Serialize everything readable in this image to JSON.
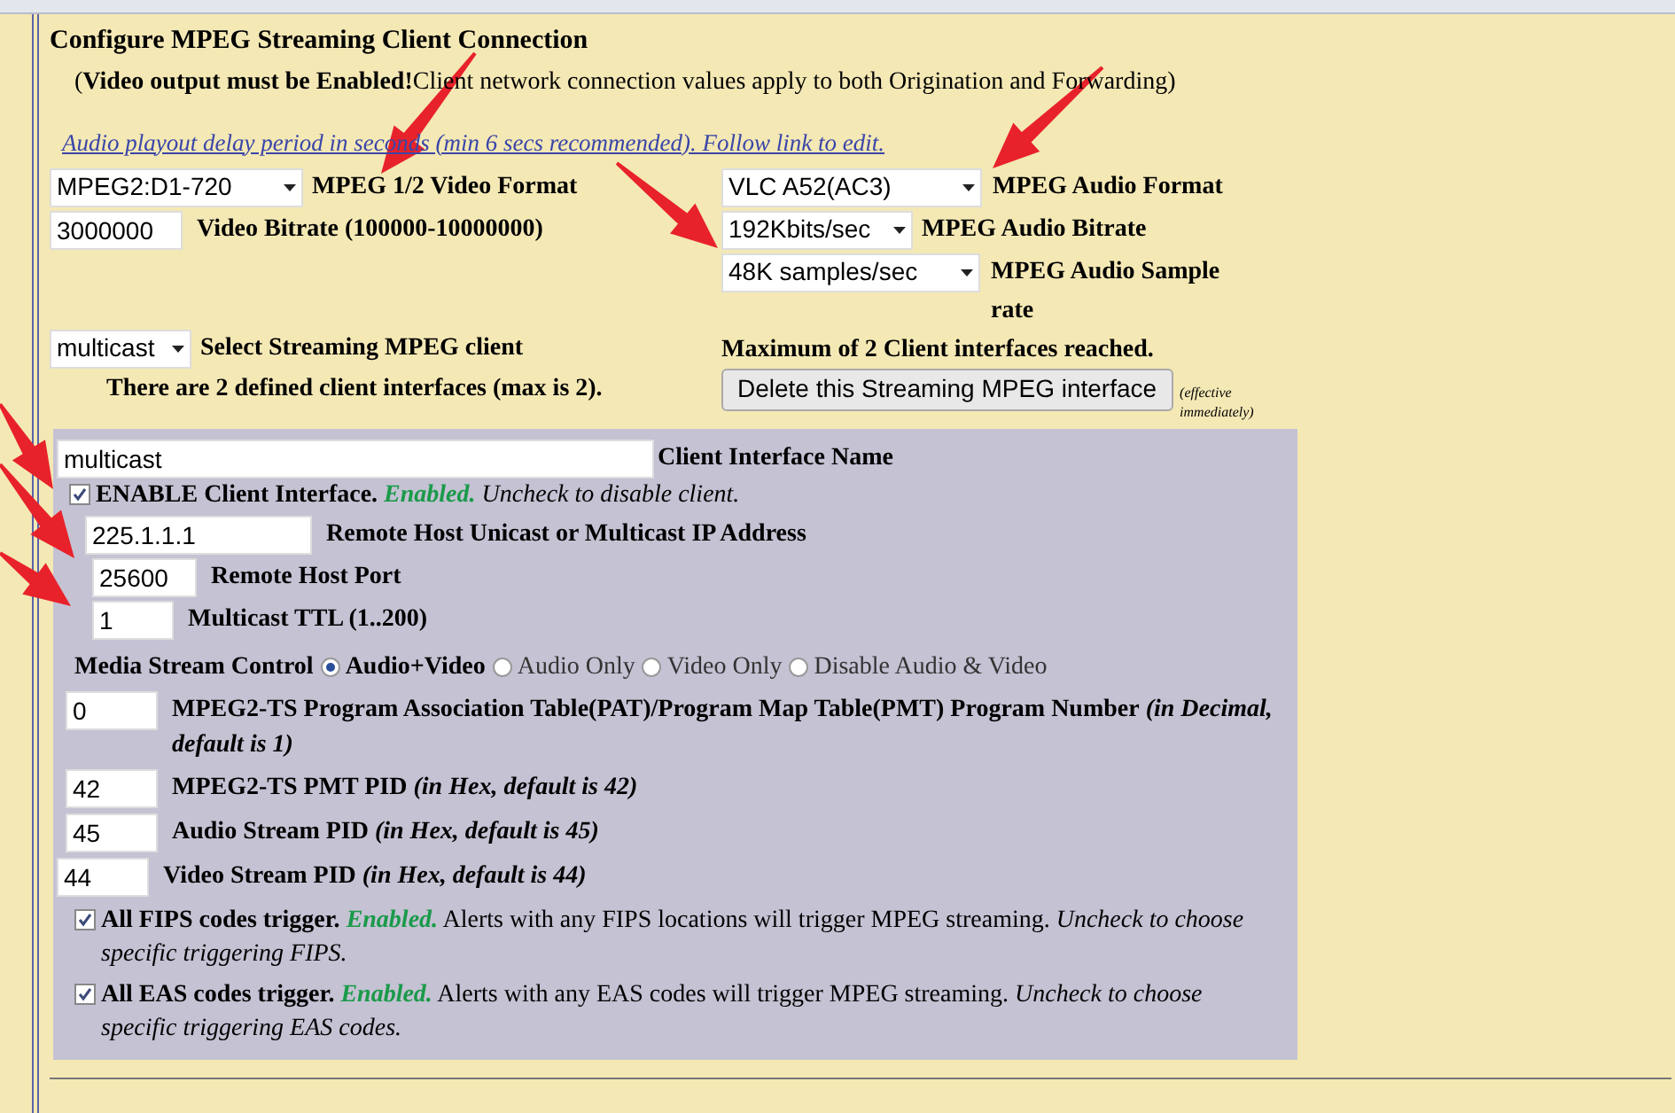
{
  "title": "Configure MPEG Streaming Client Connection",
  "note": "(**Video output must be Enabled!**Client network connection values apply to both Origination and Forwarding)",
  "link": "Audio playout delay period in seconds (min 6 secs recommended). Follow link to edit.",
  "video_format": {
    "value": "MPEG2:D1-720",
    "label": "MPEG 1/2 Video Format"
  },
  "video_bitrate": {
    "value": "3000000",
    "label": "Video Bitrate (100000-10000000)"
  },
  "audio_format": {
    "value": "VLC A52(AC3)",
    "label": "MPEG Audio Format"
  },
  "audio_bitrate": {
    "value": "192Kbits/sec",
    "label": "MPEG Audio Bitrate"
  },
  "audio_sample_rate": {
    "value": "48K samples/sec",
    "label": "MPEG Audio Sample rate"
  },
  "client_select": {
    "value": "multicast",
    "label": "Select Streaming MPEG client"
  },
  "client_count": "There are 2 defined client interfaces (max is 2).",
  "max_note": "Maximum of 2 Client interfaces reached.",
  "delete_button": "Delete this Streaming MPEG interface",
  "delete_note": "(effective immediately)",
  "client": {
    "name": {
      "value": "multicast",
      "label": "Client Interface Name"
    },
    "enable": {
      "checked": true,
      "label": "ENABLE Client Interface.",
      "status": "Enabled.",
      "hint": "Uncheck to disable client."
    },
    "host": {
      "value": "225.1.1.1",
      "label": "Remote Host Unicast or Multicast IP Address"
    },
    "port": {
      "value": "25600",
      "label": "Remote Host Port"
    },
    "ttl": {
      "value": "1",
      "label": "Multicast TTL (1..200)"
    },
    "media_stream_control": {
      "label": "Media Stream Control",
      "options": [
        {
          "label": "Audio+Video",
          "selected": true
        },
        {
          "label": "Audio Only",
          "selected": false
        },
        {
          "label": "Video Only",
          "selected": false
        },
        {
          "label": "Disable Audio & Video",
          "selected": false
        }
      ]
    },
    "pid_fields": [
      {
        "value": "0",
        "label": "MPEG2-TS Program Association Table(PAT)/Program Map Table(PMT) Program Number",
        "hint": "(in Decimal, default is 1)"
      },
      {
        "value": "42",
        "label": "MPEG2-TS PMT PID",
        "hint": "(in Hex, default is 42)"
      },
      {
        "value": "45",
        "label": "Audio Stream PID",
        "hint": "(in Hex, default is 45)"
      },
      {
        "value": "44",
        "label": "Video Stream PID",
        "hint": "(in Hex, default is 44)"
      }
    ],
    "triggers": [
      {
        "checked": true,
        "label": "All FIPS codes trigger.",
        "status": "Enabled.",
        "text": "Alerts with any FIPS locations will trigger MPEG streaming.",
        "hint": "Uncheck to choose specific triggering FIPS."
      },
      {
        "checked": true,
        "label": "All EAS codes trigger.",
        "status": "Enabled.",
        "text": "Alerts with any EAS codes will trigger MPEG streaming.",
        "hint": "Uncheck to choose specific triggering EAS codes."
      }
    ]
  }
}
